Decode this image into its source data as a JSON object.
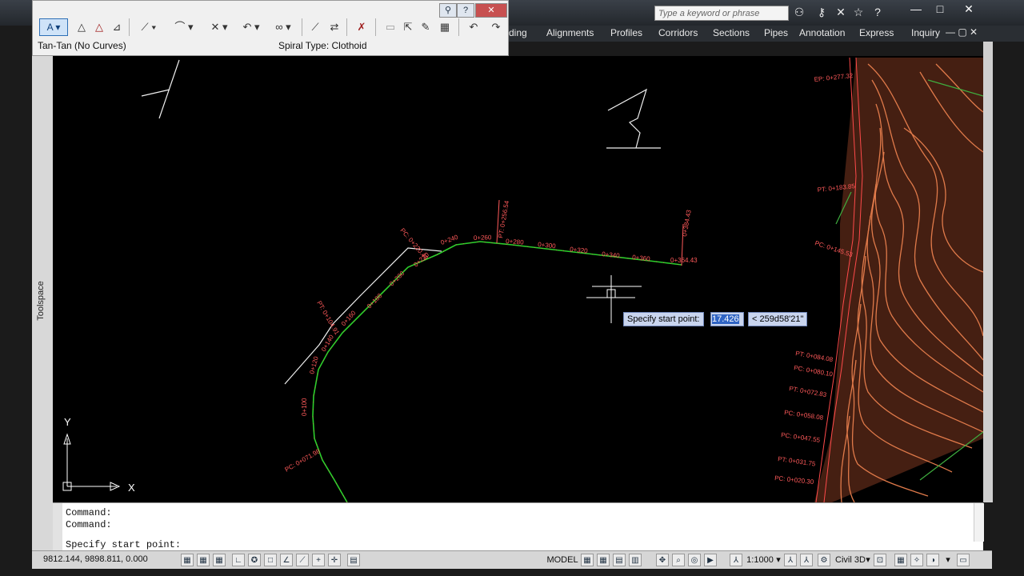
{
  "toolbar": {
    "curve_type": "A",
    "mode_label": "Tan-Tan (No Curves)",
    "spiral_label": "Spiral Type: Clothoid",
    "help": "?",
    "close": "✕",
    "pin": "⚲"
  },
  "ribbon": {
    "tabs": [
      "ding",
      "Alignments",
      "Profiles",
      "Corridors",
      "Sections",
      "Pipes",
      "Annotation",
      "Express",
      "Inquiry"
    ],
    "search_placeholder": "Type a keyword or phrase"
  },
  "toolspace": {
    "label": "Toolspace"
  },
  "cursor_prompt": {
    "label": "Specify start point:",
    "value": "17.426",
    "angle": "< 259d58'21\""
  },
  "ucs": {
    "x_label": "X",
    "y_label": "Y"
  },
  "stations": {
    "lower": [
      "0+100",
      "0+120",
      "0+140",
      "0+160",
      "0+180",
      "0+200",
      "0+220",
      "0+240"
    ],
    "upper": [
      "0+260",
      "0+280",
      "0+300",
      "0+320",
      "0+340",
      "0+360"
    ],
    "special": [
      "PC: 0+071.98",
      "PT: 0+104.91",
      "PC: 0+220.48",
      "PT: 0+256.54",
      "0+364.43",
      "0+384.43"
    ],
    "right": [
      "EP: 0+277.32",
      "PT: 0+183.85",
      "PC: 0+145.53",
      "PT: 0+084.08",
      "PC: 0+080.10",
      "PT: 0+072.83",
      "PC: 0+058.08",
      "PC: 0+047.55",
      "PT: 0+031.75",
      "PC: 0+020.30"
    ]
  },
  "command": {
    "lines": [
      "Command:",
      "Command:"
    ],
    "current": "Specify start point:"
  },
  "status": {
    "coords": "9812.144, 9898.811, 0.000",
    "model": "MODEL",
    "scale": "1:1000",
    "workspace": "Civil 3D"
  }
}
